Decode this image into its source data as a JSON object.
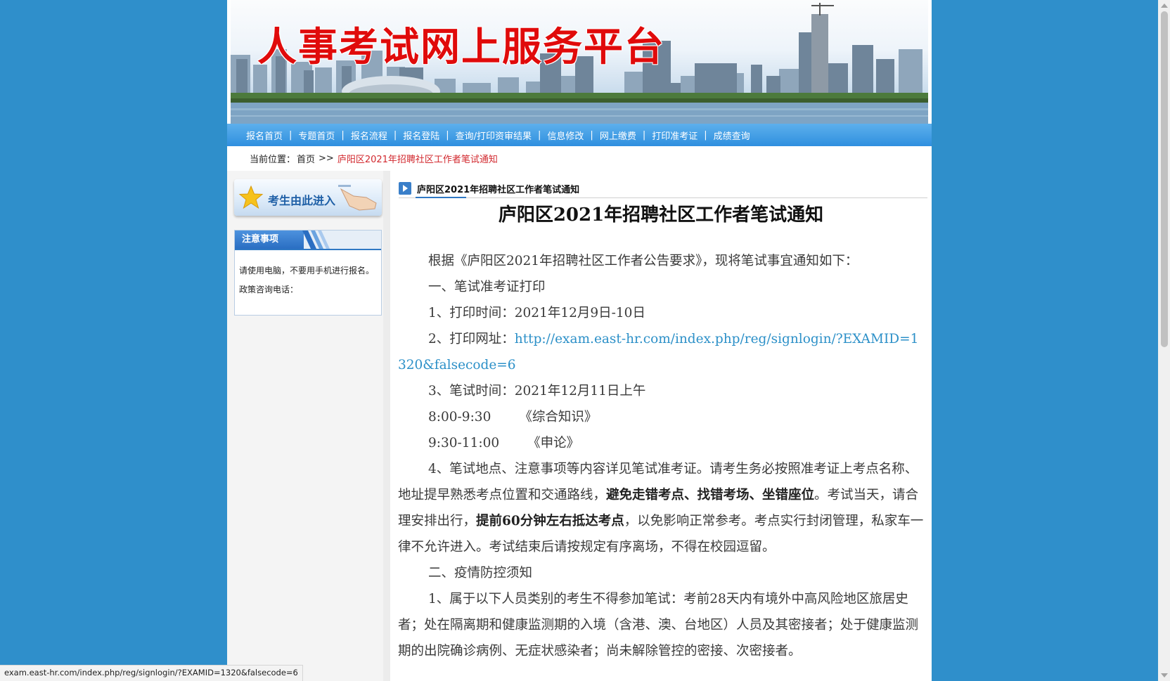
{
  "banner": {
    "title": "人事考试网上服务平台"
  },
  "nav": {
    "items": [
      "报名首页",
      "专题首页",
      "报名流程",
      "报名登陆",
      "查询/打印资审结果",
      "信息修改",
      "网上缴费",
      "打印准考证",
      "成绩查询"
    ],
    "separator": "|"
  },
  "breadcrumb": {
    "prefix": "当前位置：",
    "home": "首页",
    "arrows": ">>",
    "current": "庐阳区2021年招聘社区工作者笔试通知"
  },
  "sidebar": {
    "enter_label": "考生由此进入",
    "notice_title": "注意事项",
    "notice_text": "请使用电脑，不要用手机进行报名。",
    "phone_label": "政策咨询电话："
  },
  "article": {
    "section_header": "庐阳区2021年招聘社区工作者笔试通知",
    "title": "庐阳区2021年招聘社区工作者笔试通知",
    "intro": "根据《庐阳区2021年招聘社区工作者公告要求》，现将笔试事宜通知如下：",
    "s1": "一、笔试准考证打印",
    "p1": "1、打印时间：2021年12月9日-10日",
    "p2_label": "2、打印网址：",
    "p2_url": "http://exam.east-hr.com/index.php/reg/signlogin/?EXAMID=1320&falsecode=6",
    "p3": "3、笔试时间：2021年12月11日上午",
    "time1": "8:00-9:30",
    "subject1": "《综合知识》",
    "time2": "9:30-11:00",
    "subject2": "《申论》",
    "p4_a": "4、笔试地点、注意事项等内容详见笔试准考证。请考生务必按照准考证上考点名称、地址提早熟悉考点位置和交通路线，",
    "p4_b": "避免走错考点、找错考场、坐错座位",
    "p4_c": "。考试当天，请合理安排出行，",
    "p4_d": "提前60分钟左右抵达考点",
    "p4_e": "，以免影响正常参考。考点实行封闭管理，私家车一律不允许进入。考试结束后请按规定有序离场，不得在校园逗留。",
    "s2": "二、疫情防控须知",
    "p5": "1、属于以下人员类别的考生不得参加笔试：考前28天内有境外中高风险地区旅居史者；处在隔离期和健康监测期的入境（含港、澳、台地区）人员及其密接者；处于健康监测期的出院确诊病例、无症状感染者；尚未解除管控的密接、次密接者。"
  },
  "statusbar": {
    "url": "exam.east-hr.com/index.php/reg/signlogin/?EXAMID=1320&falsecode=6"
  }
}
